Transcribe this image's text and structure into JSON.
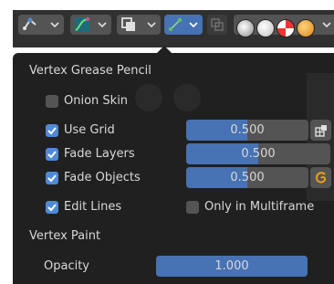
{
  "header": {
    "tools": [
      {
        "name": "select-mode-icon"
      },
      {
        "name": "curve-icon"
      },
      {
        "name": "overlay-icon"
      },
      {
        "name": "gizmo-icon"
      }
    ],
    "shading_modes": [
      "wireframe",
      "solid",
      "material-preview",
      "rendered"
    ]
  },
  "popover": {
    "section_grease_pencil": "Vertex Grease Pencil",
    "onion_skin": {
      "label": "Onion Skin",
      "checked": false
    },
    "use_grid": {
      "label": "Use Grid",
      "checked": true,
      "value": "0.500",
      "fraction": 0.5
    },
    "fade_layers": {
      "label": "Fade Layers",
      "checked": true,
      "value": "0.500",
      "fraction": 0.5
    },
    "fade_objects": {
      "label": "Fade Objects",
      "checked": true,
      "value": "0.500",
      "fraction": 0.5
    },
    "edit_lines": {
      "label": "Edit Lines",
      "checked": true
    },
    "only_in_multiframe": {
      "label": "Only in Multiframe",
      "checked": false
    },
    "section_vertex_paint": "Vertex Paint",
    "opacity": {
      "label": "Opacity",
      "value": "1.000",
      "fraction": 1.0
    }
  },
  "colors": {
    "accent": "#4772b3",
    "checkbox_on": "#4f8ad6",
    "panel_bg": "#202020",
    "header_bg": "#303030",
    "widget_bg": "#545454",
    "text": "#d9d9d9",
    "fade_objects_icon": "#e8a317"
  }
}
